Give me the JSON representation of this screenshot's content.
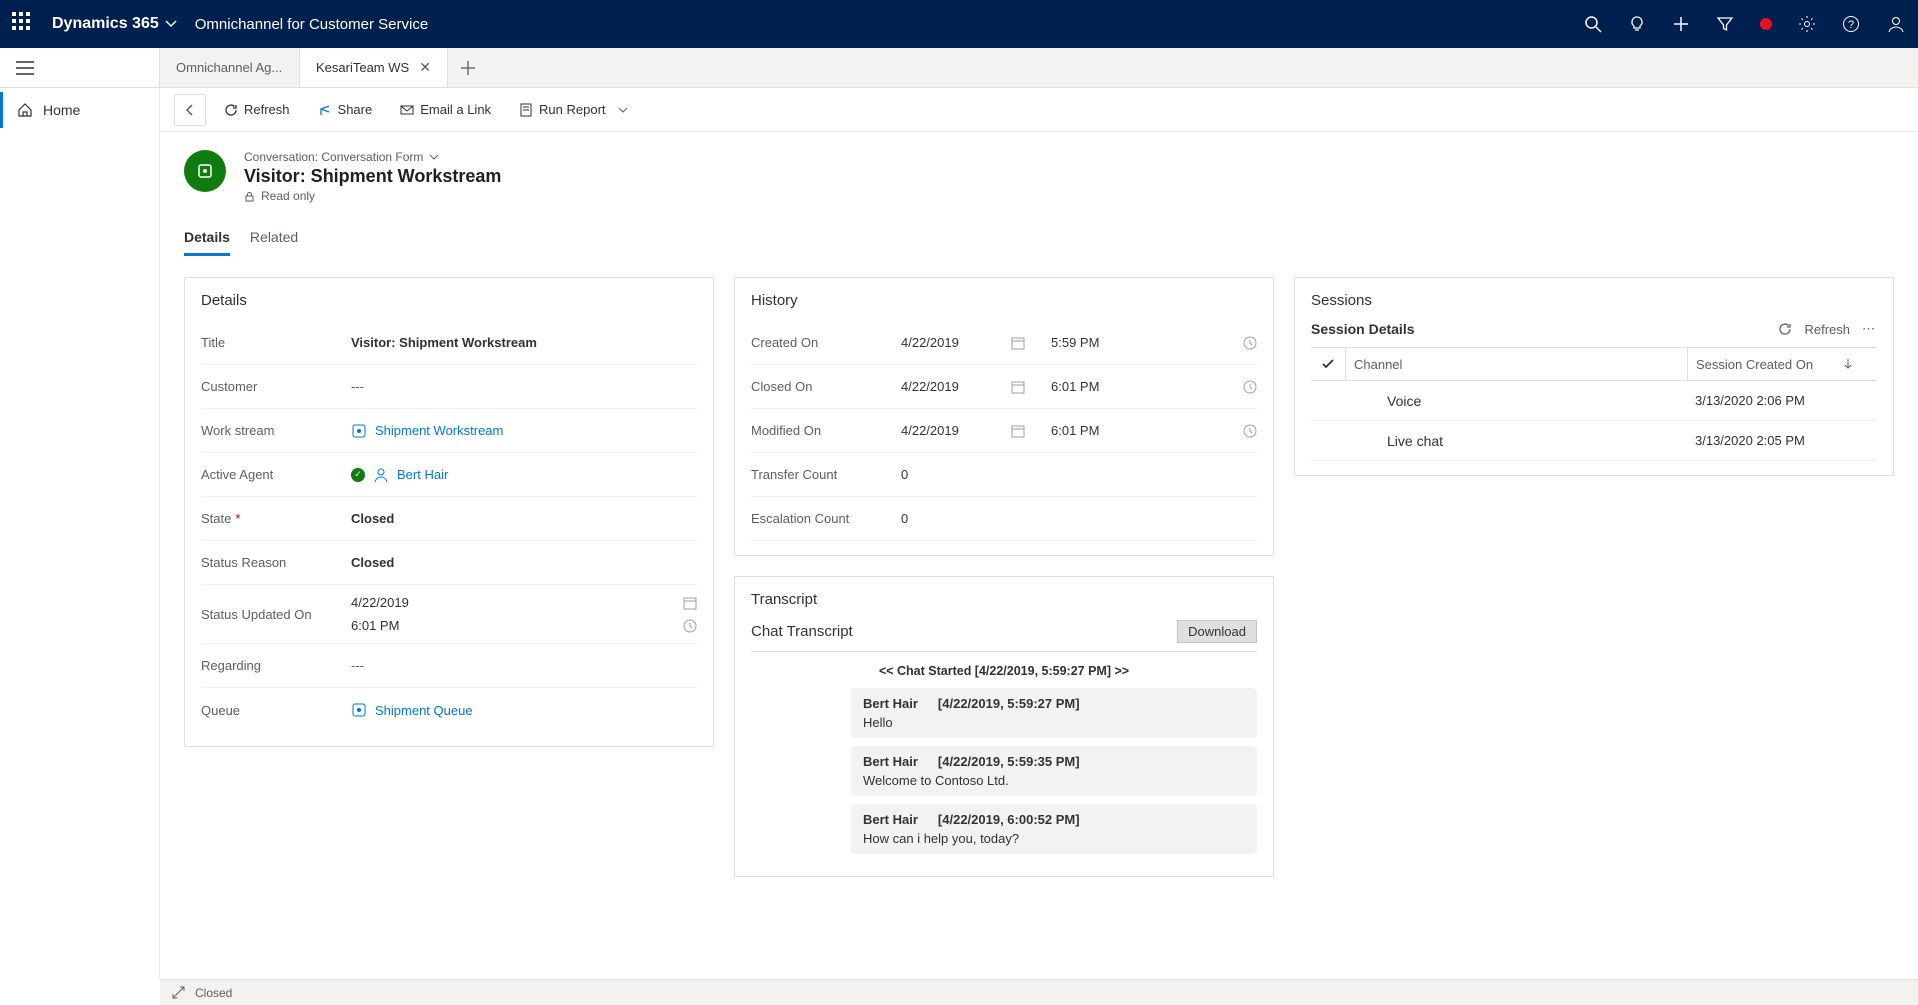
{
  "topnav": {
    "brand": "Dynamics 365",
    "app_name": "Omnichannel for Customer Service"
  },
  "tabs": [
    {
      "label": "Omnichannel Ag...",
      "active": false
    },
    {
      "label": "KesariTeam WS",
      "active": true,
      "closable": true
    }
  ],
  "sidebar": {
    "home": "Home"
  },
  "commands": {
    "refresh": "Refresh",
    "share": "Share",
    "email_link": "Email a Link",
    "run_report": "Run Report"
  },
  "header": {
    "form_label": "Conversation: Conversation Form",
    "title": "Visitor: Shipment Workstream",
    "readonly": "Read only"
  },
  "subtabs": {
    "details": "Details",
    "related": "Related"
  },
  "details_panel": {
    "title": "Details",
    "fields": {
      "title_lbl": "Title",
      "title_val": "Visitor: Shipment Workstream",
      "customer_lbl": "Customer",
      "customer_val": "---",
      "workstream_lbl": "Work stream",
      "workstream_val": "Shipment Workstream",
      "agent_lbl": "Active Agent",
      "agent_val": "Bert Hair",
      "state_lbl": "State",
      "state_val": "Closed",
      "status_reason_lbl": "Status Reason",
      "status_reason_val": "Closed",
      "status_updated_lbl": "Status Updated On",
      "status_updated_date": "4/22/2019",
      "status_updated_time": "6:01 PM",
      "regarding_lbl": "Regarding",
      "regarding_val": "---",
      "queue_lbl": "Queue",
      "queue_val": "Shipment Queue"
    }
  },
  "history_panel": {
    "title": "History",
    "rows": [
      {
        "lbl": "Created On",
        "date": "4/22/2019",
        "time": "5:59 PM",
        "has_time": true
      },
      {
        "lbl": "Closed On",
        "date": "4/22/2019",
        "time": "6:01 PM",
        "has_time": true
      },
      {
        "lbl": "Modified On",
        "date": "4/22/2019",
        "time": "6:01 PM",
        "has_time": true
      },
      {
        "lbl": "Transfer Count",
        "date": "0",
        "time": "",
        "has_time": false
      },
      {
        "lbl": "Escalation Count",
        "date": "0",
        "time": "",
        "has_time": false
      }
    ]
  },
  "sessions_panel": {
    "title": "Sessions",
    "subtitle": "Session Details",
    "refresh": "Refresh",
    "col_channel": "Channel",
    "col_created": "Session Created On",
    "rows": [
      {
        "channel": "Voice",
        "created": "3/13/2020 2:06 PM"
      },
      {
        "channel": "Live chat",
        "created": "3/13/2020 2:05 PM"
      }
    ]
  },
  "transcript_panel": {
    "title": "Transcript",
    "chat_title": "Chat Transcript",
    "download": "Download",
    "started": "<< Chat Started [4/22/2019, 5:59:27 PM] >>",
    "messages": [
      {
        "sender": "Bert Hair",
        "ts": "[4/22/2019, 5:59:27 PM]",
        "body": "Hello"
      },
      {
        "sender": "Bert Hair",
        "ts": "[4/22/2019, 5:59:35 PM]",
        "body": "Welcome to Contoso Ltd."
      },
      {
        "sender": "Bert Hair",
        "ts": "[4/22/2019, 6:00:52 PM]",
        "body": "How can i help you, today?"
      }
    ]
  },
  "statusbar": {
    "status": "Closed"
  }
}
